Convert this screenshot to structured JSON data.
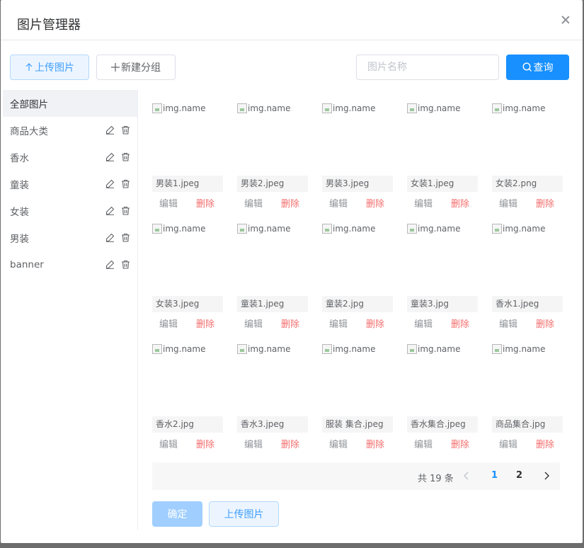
{
  "dialog": {
    "title": "图片管理器"
  },
  "toolbar": {
    "upload_label": "上传图片",
    "new_group_label": "新建分组",
    "search_placeholder": "图片名称",
    "search_value": "",
    "query_label": "查询"
  },
  "sidebar": {
    "all_label": "全部图片",
    "groups": [
      {
        "label": "商品大类"
      },
      {
        "label": "香水"
      },
      {
        "label": "童装"
      },
      {
        "label": "女装"
      },
      {
        "label": "男装"
      },
      {
        "label": "banner"
      }
    ]
  },
  "images": [
    {
      "alt": "img.name",
      "name": "男装1.jpeg"
    },
    {
      "alt": "img.name",
      "name": "男装2.jpeg"
    },
    {
      "alt": "img.name",
      "name": "男装3.jpeg"
    },
    {
      "alt": "img.name",
      "name": "女装1.jpeg"
    },
    {
      "alt": "img.name",
      "name": "女装2.png"
    },
    {
      "alt": "img.name",
      "name": "女装3.jpeg"
    },
    {
      "alt": "img.name",
      "name": "童装1.jpeg"
    },
    {
      "alt": "img.name",
      "name": "童装2.jpg"
    },
    {
      "alt": "img.name",
      "name": "童装3.jpg"
    },
    {
      "alt": "img.name",
      "name": "香水1.jpeg"
    },
    {
      "alt": "img.name",
      "name": "香水2.jpg"
    },
    {
      "alt": "img.name",
      "name": "香水3.jpeg"
    },
    {
      "alt": "img.name",
      "name": "服装 集合.jpeg"
    },
    {
      "alt": "img.name",
      "name": "香水集合.jpeg"
    },
    {
      "alt": "img.name",
      "name": "商品集合.jpg"
    }
  ],
  "card_actions": {
    "edit_label": "编辑",
    "delete_label": "删除"
  },
  "pagination": {
    "total_label": "共 19 条",
    "pages": [
      "1",
      "2"
    ],
    "current": "1"
  },
  "footer": {
    "confirm_label": "确定",
    "upload_label": "上传图片"
  },
  "colors": {
    "primary": "#1890ff",
    "danger": "#f56c6c",
    "light_primary": "#ecf5ff"
  }
}
